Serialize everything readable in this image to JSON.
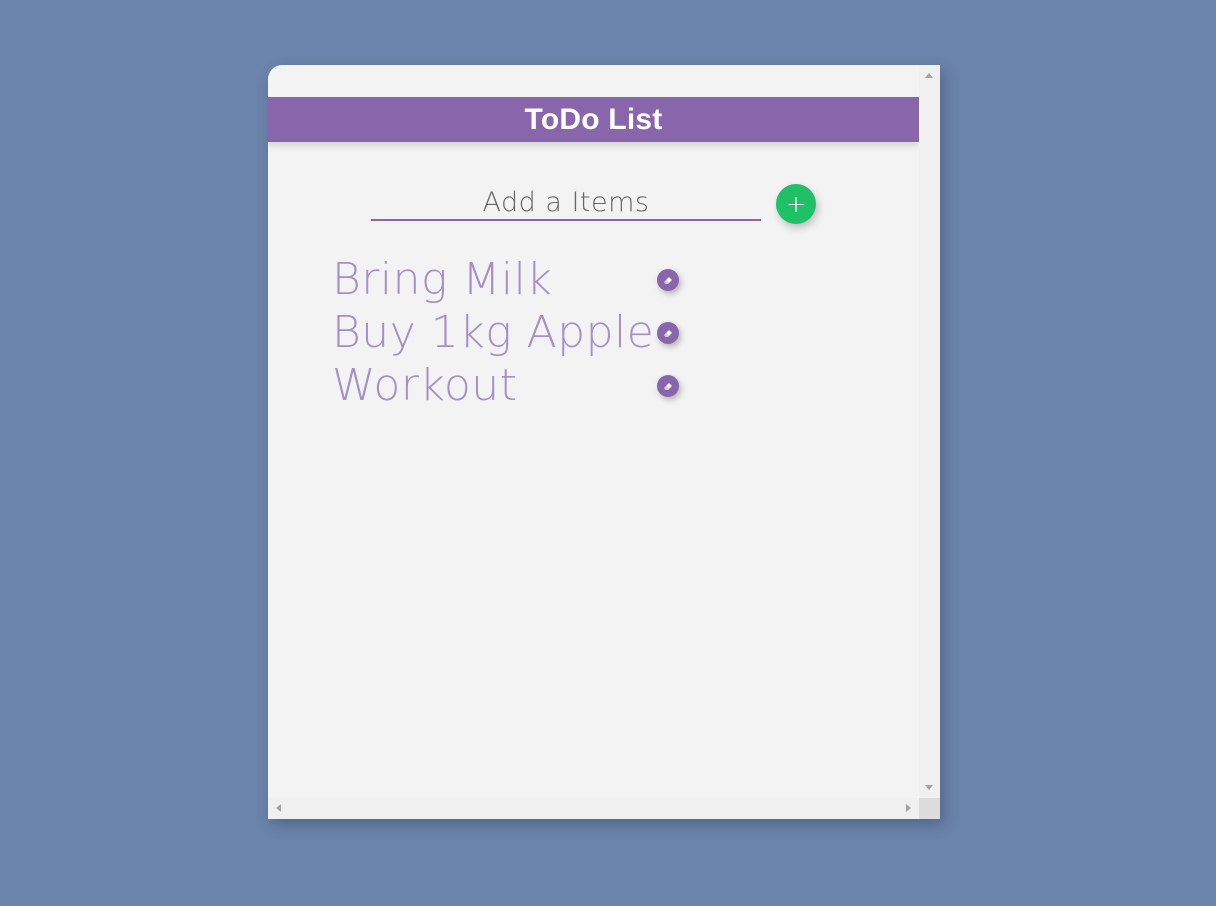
{
  "app": {
    "title": "ToDo List"
  },
  "input": {
    "placeholder": "Add a Items",
    "value": ""
  },
  "add_button": {
    "icon": "plus-icon",
    "label": "+"
  },
  "items": [
    {
      "text": "Bring Milk",
      "action_icon": "eraser-icon"
    },
    {
      "text": "Buy 1kg Apple",
      "action_icon": "eraser-icon"
    },
    {
      "text": "Workout",
      "action_icon": "eraser-icon"
    }
  ],
  "colors": {
    "background": "#6b84ab",
    "card": "#f3f3f3",
    "accent": "#8966ab",
    "item_text": "#a58fc8",
    "add_button": "#20c067"
  }
}
